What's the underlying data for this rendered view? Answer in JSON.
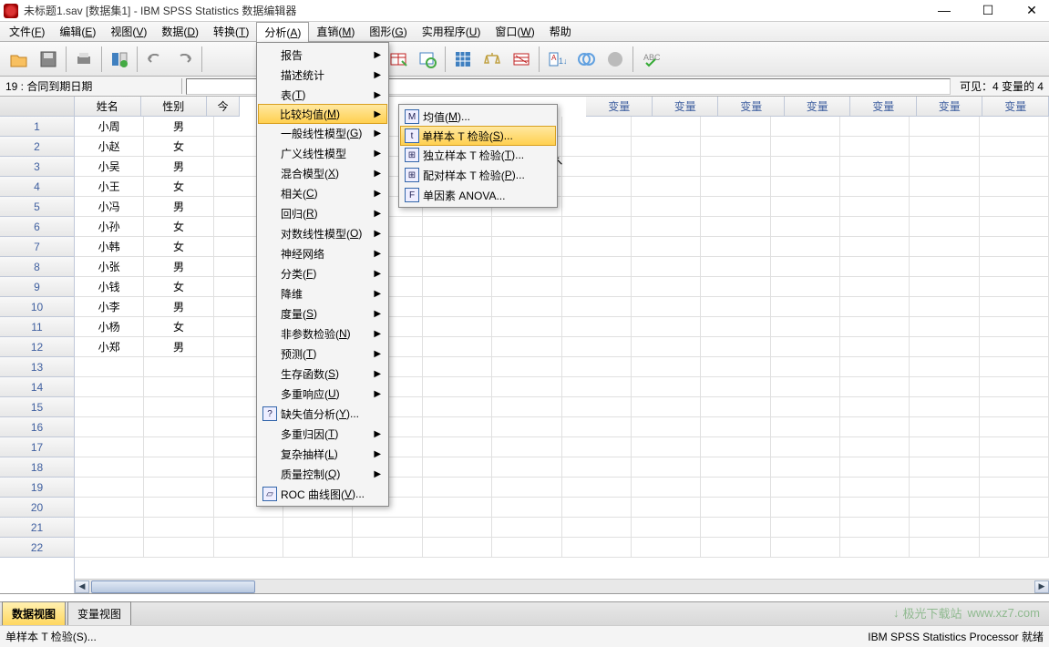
{
  "titlebar": {
    "title": "未标题1.sav [数据集1] - IBM SPSS Statistics 数据编辑器"
  },
  "menubar": {
    "items": [
      "文件(F)",
      "编辑(E)",
      "视图(V)",
      "数据(D)",
      "转换(T)",
      "分析(A)",
      "直销(M)",
      "图形(G)",
      "实用程序(U)",
      "窗口(W)",
      "帮助"
    ],
    "active_index": 5
  },
  "selrow": {
    "label": "19 : 合同到期日期",
    "visible": "可见：4 变量的 4"
  },
  "columns": {
    "named": [
      "姓名",
      "性别"
    ],
    "extra_label": "变量",
    "extra_count": 12,
    "partial_label": "今"
  },
  "rows": {
    "count": 22,
    "data": [
      {
        "n": "小周",
        "s": "男"
      },
      {
        "n": "小赵",
        "s": "女"
      },
      {
        "n": "小吴",
        "s": "男"
      },
      {
        "n": "小王",
        "s": "女"
      },
      {
        "n": "小冯",
        "s": "男"
      },
      {
        "n": "小孙",
        "s": "女"
      },
      {
        "n": "小韩",
        "s": "女"
      },
      {
        "n": "小张",
        "s": "男"
      },
      {
        "n": "小钱",
        "s": "女"
      },
      {
        "n": "小李",
        "s": "男"
      },
      {
        "n": "小杨",
        "s": "女"
      },
      {
        "n": "小郑",
        "s": "男"
      }
    ]
  },
  "menu1": {
    "items": [
      {
        "l": "报告",
        "a": true
      },
      {
        "l": "描述统计",
        "a": true
      },
      {
        "l": "表(T)",
        "a": true
      },
      {
        "l": "比较均值(M)",
        "a": true,
        "hov": true
      },
      {
        "l": "一般线性模型(G)",
        "a": true
      },
      {
        "l": "广义线性模型",
        "a": true
      },
      {
        "l": "混合模型(X)",
        "a": true
      },
      {
        "l": "相关(C)",
        "a": true
      },
      {
        "l": "回归(R)",
        "a": true
      },
      {
        "l": "对数线性模型(O)",
        "a": true
      },
      {
        "l": "神经网络",
        "a": true
      },
      {
        "l": "分类(F)",
        "a": true
      },
      {
        "l": "降维",
        "a": true
      },
      {
        "l": "度量(S)",
        "a": true
      },
      {
        "l": "非参数检验(N)",
        "a": true
      },
      {
        "l": "预测(T)",
        "a": true
      },
      {
        "l": "生存函数(S)",
        "a": true
      },
      {
        "l": "多重响应(U)",
        "a": true
      },
      {
        "l": "缺失值分析(Y)...",
        "a": false,
        "icon": "?"
      },
      {
        "l": "多重归因(T)",
        "a": true
      },
      {
        "l": "复杂抽样(L)",
        "a": true
      },
      {
        "l": "质量控制(Q)",
        "a": true
      },
      {
        "l": "ROC 曲线图(V)...",
        "a": false,
        "icon": "▱"
      }
    ]
  },
  "menu2": {
    "items": [
      {
        "l": "均值(M)...",
        "icon": "M"
      },
      {
        "l": "单样本 T 检验(S)...",
        "icon": "t",
        "hov": true
      },
      {
        "l": "独立样本 T 检验(T)...",
        "icon": "⊞"
      },
      {
        "l": "配对样本 T 检验(P)...",
        "icon": "⊞"
      },
      {
        "l": "单因素 ANOVA...",
        "icon": "F"
      }
    ]
  },
  "tabs": {
    "items": [
      "数据视图",
      "变量视图"
    ],
    "active_index": 0
  },
  "status": {
    "left": "单样本 T 检验(S)...",
    "right": "IBM SPSS Statistics Processor 就绪"
  },
  "watermark": {
    "name": "极光下载站",
    "url": "www.xz7.com"
  }
}
